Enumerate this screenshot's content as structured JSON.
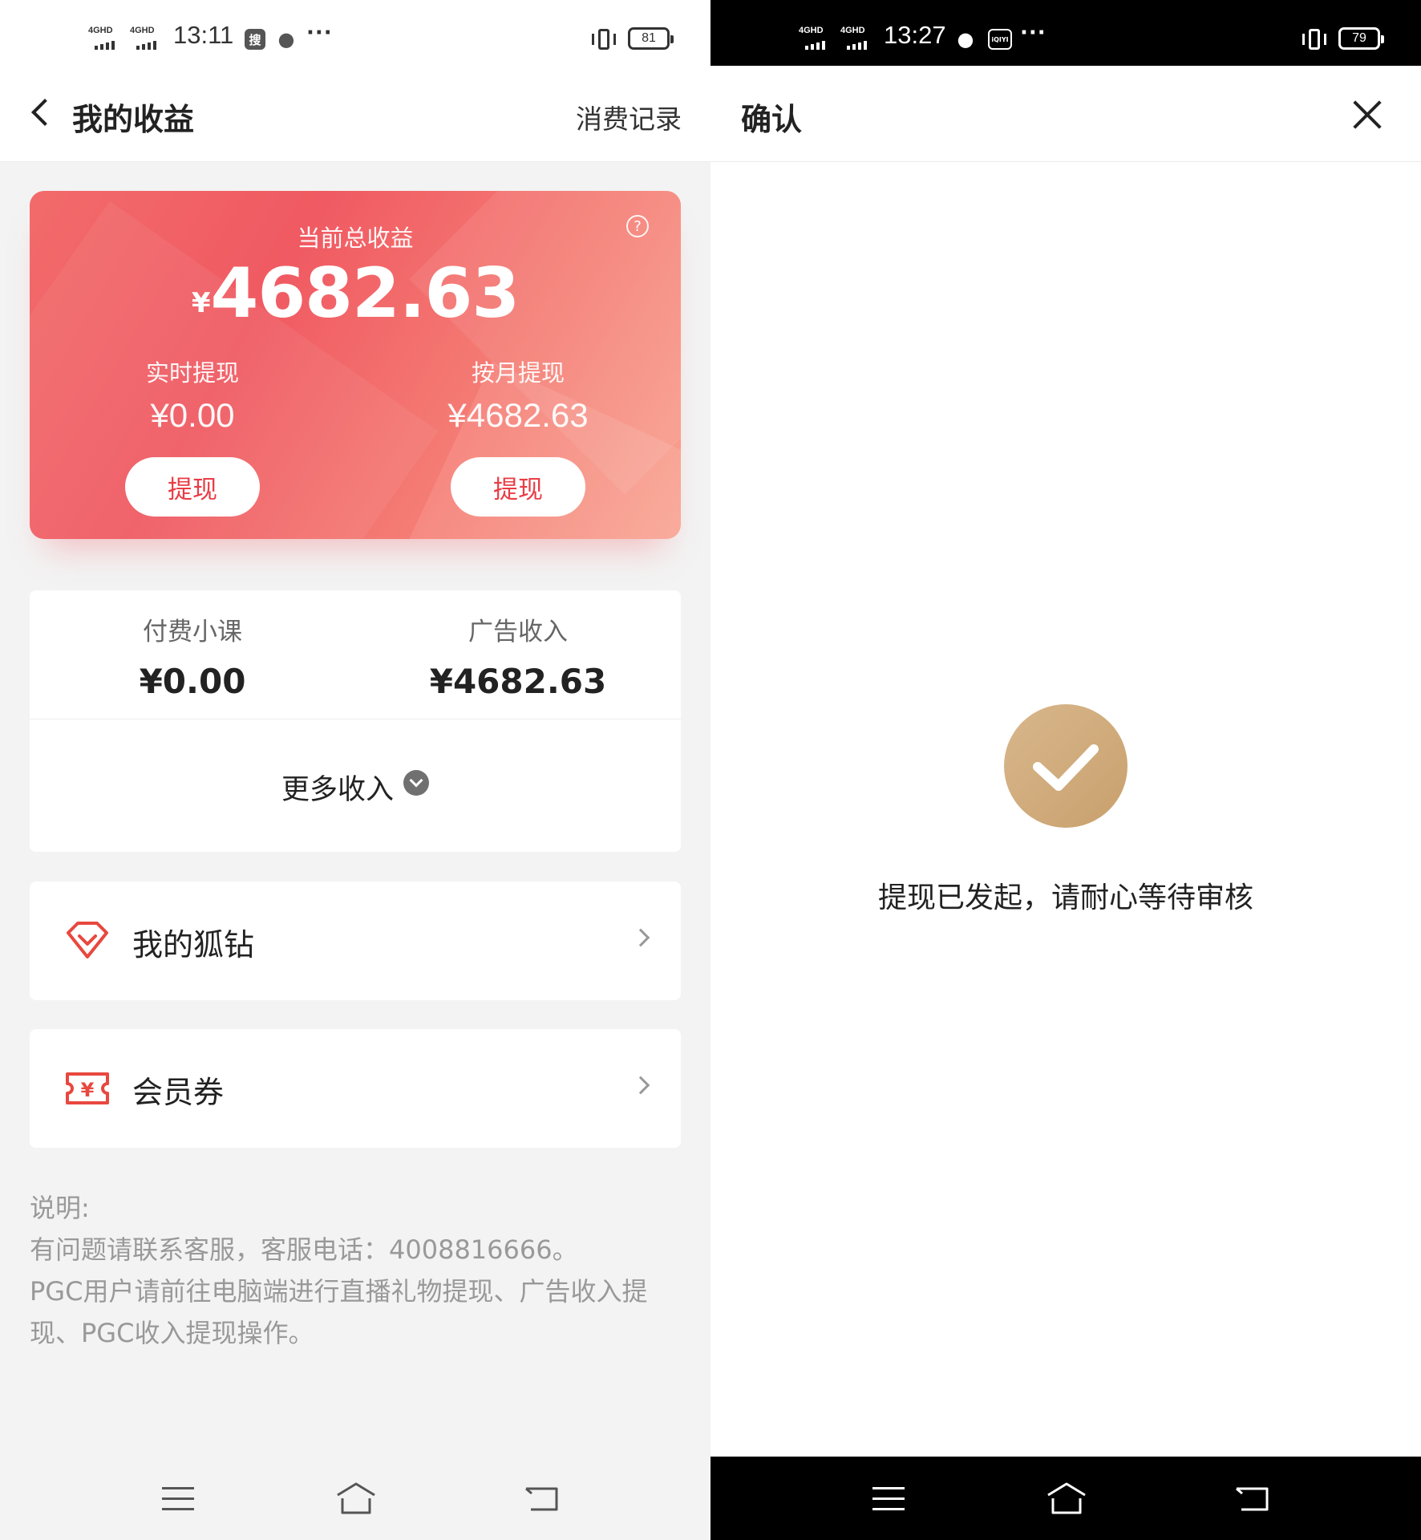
{
  "left": {
    "status": {
      "net1": "4GHD",
      "net2": "4GHD",
      "time": "13:11",
      "app_icon": "搜",
      "battery": "81"
    },
    "header": {
      "title": "我的收益",
      "action": "消费记录"
    },
    "card": {
      "label": "当前总收益",
      "currency": "¥",
      "total": "4682.63",
      "help_icon": "?",
      "realtime": {
        "label": "实时提现",
        "value": "¥0.00",
        "button": "提现"
      },
      "monthly": {
        "label": "按月提现",
        "value": "¥4682.63",
        "button": "提现"
      }
    },
    "income": {
      "paid_course": {
        "label": "付费小课",
        "value": "¥0.00"
      },
      "ad_income": {
        "label": "广告收入",
        "value": "¥4682.63"
      },
      "more": "更多收入"
    },
    "rows": {
      "fox_diamond": "我的狐钻",
      "coupon": "会员券",
      "coupon_symbol": "¥"
    },
    "note": {
      "title": "说明:",
      "line1": "有问题请联系客服，客服电话：4008816666。",
      "line2": "PGC用户请前往电脑端进行直播礼物提现、广告收入提现、PGC收入提现操作。"
    },
    "colors": {
      "card_red": "#f05a62",
      "button_text": "#e93c45"
    }
  },
  "right": {
    "status": {
      "net1": "4GHD",
      "net2": "4GHD",
      "time": "13:27",
      "app_icon": "iQIYI",
      "battery": "79"
    },
    "header": {
      "title": "确认"
    },
    "message": "提现已发起，请耐心等待审核",
    "colors": {
      "check_gold": "#c9a06d"
    }
  }
}
